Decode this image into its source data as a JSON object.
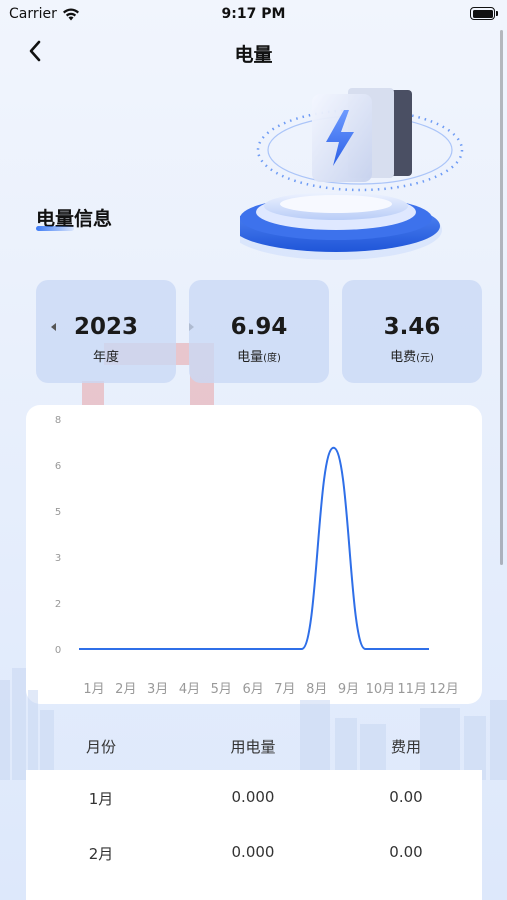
{
  "status_bar": {
    "carrier": "Carrier",
    "time": "9:17 PM"
  },
  "nav": {
    "title": "电量"
  },
  "section": {
    "title": "电量信息"
  },
  "cards": {
    "year": {
      "value": "2023",
      "label": "年度"
    },
    "kwh": {
      "value": "6.94",
      "label": "电量",
      "unit": "(度)"
    },
    "cost": {
      "value": "3.46",
      "label": "电费",
      "unit": "(元)"
    }
  },
  "icons": {
    "back": "chevron-left-icon",
    "wifi": "wifi-icon",
    "battery": "battery-icon",
    "prev_year": "caret-left-icon",
    "next_year": "caret-right-icon"
  },
  "colors": {
    "accent": "#3d7bf5",
    "line": "#2f6fe8"
  },
  "chart_data": {
    "type": "line",
    "categories": [
      "1月",
      "2月",
      "3月",
      "4月",
      "5月",
      "6月",
      "7月",
      "8月",
      "9月",
      "10月",
      "11月",
      "12月"
    ],
    "values": [
      0,
      0,
      0,
      0,
      0,
      0,
      0,
      0,
      7.0,
      0,
      0,
      0
    ],
    "y_ticks": [
      "8",
      "6",
      "5",
      "3",
      "2",
      "0"
    ],
    "ylim": [
      0,
      8
    ],
    "smooth": true,
    "grid": false
  },
  "table": {
    "headers": [
      "月份",
      "用电量",
      "费用"
    ],
    "rows": [
      {
        "month": "1月",
        "kwh": "0.000",
        "cost": "0.00"
      },
      {
        "month": "2月",
        "kwh": "0.000",
        "cost": "0.00"
      }
    ]
  }
}
